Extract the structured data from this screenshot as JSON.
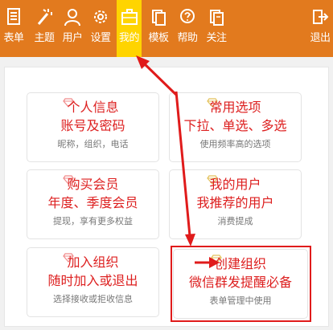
{
  "nav": {
    "items": [
      {
        "label": "表单",
        "icon": "form-icon"
      },
      {
        "label": "主题",
        "icon": "magic-wand-icon"
      },
      {
        "label": "用户",
        "icon": "user-icon"
      },
      {
        "label": "设置",
        "icon": "gear-icon"
      },
      {
        "label": "我的",
        "icon": "briefcase-icon",
        "active": true
      },
      {
        "label": "模板",
        "icon": "template-icon"
      },
      {
        "label": "帮助",
        "icon": "help-chat-icon"
      },
      {
        "label": "关注",
        "icon": "follow-icon"
      },
      {
        "label": "退出",
        "icon": "logout-icon"
      }
    ]
  },
  "cards": [
    {
      "title": "个人信息",
      "subtitle": "账号及密码",
      "desc": "昵称，组织，电话",
      "gem_color": "#f08a8a"
    },
    {
      "title": "常用选项",
      "subtitle": "下拉、单选、多选",
      "desc": "使用频率高的选项",
      "gem_color": "#e3c15a"
    },
    {
      "title": "购买会员",
      "subtitle": "年度、季度会员",
      "desc": "提现，享有更多权益",
      "gem_color": "#f08a8a"
    },
    {
      "title": "我的用户",
      "subtitle": "我推荐的用户",
      "desc": "消费提成",
      "gem_color": "#e3c15a"
    },
    {
      "title": "加入组织",
      "subtitle": "随时加入或退出",
      "desc": "选择接收或拒收信息",
      "gem_color": "#f08a8a"
    },
    {
      "title": "创建组织",
      "subtitle": "微信群发提醒必备",
      "desc": "表单管理中使用",
      "gem_color": "#e3c15a"
    }
  ],
  "colors": {
    "topbar": "#e27a1e",
    "active": "#ffd400",
    "accent_red": "#dd1f1f"
  }
}
